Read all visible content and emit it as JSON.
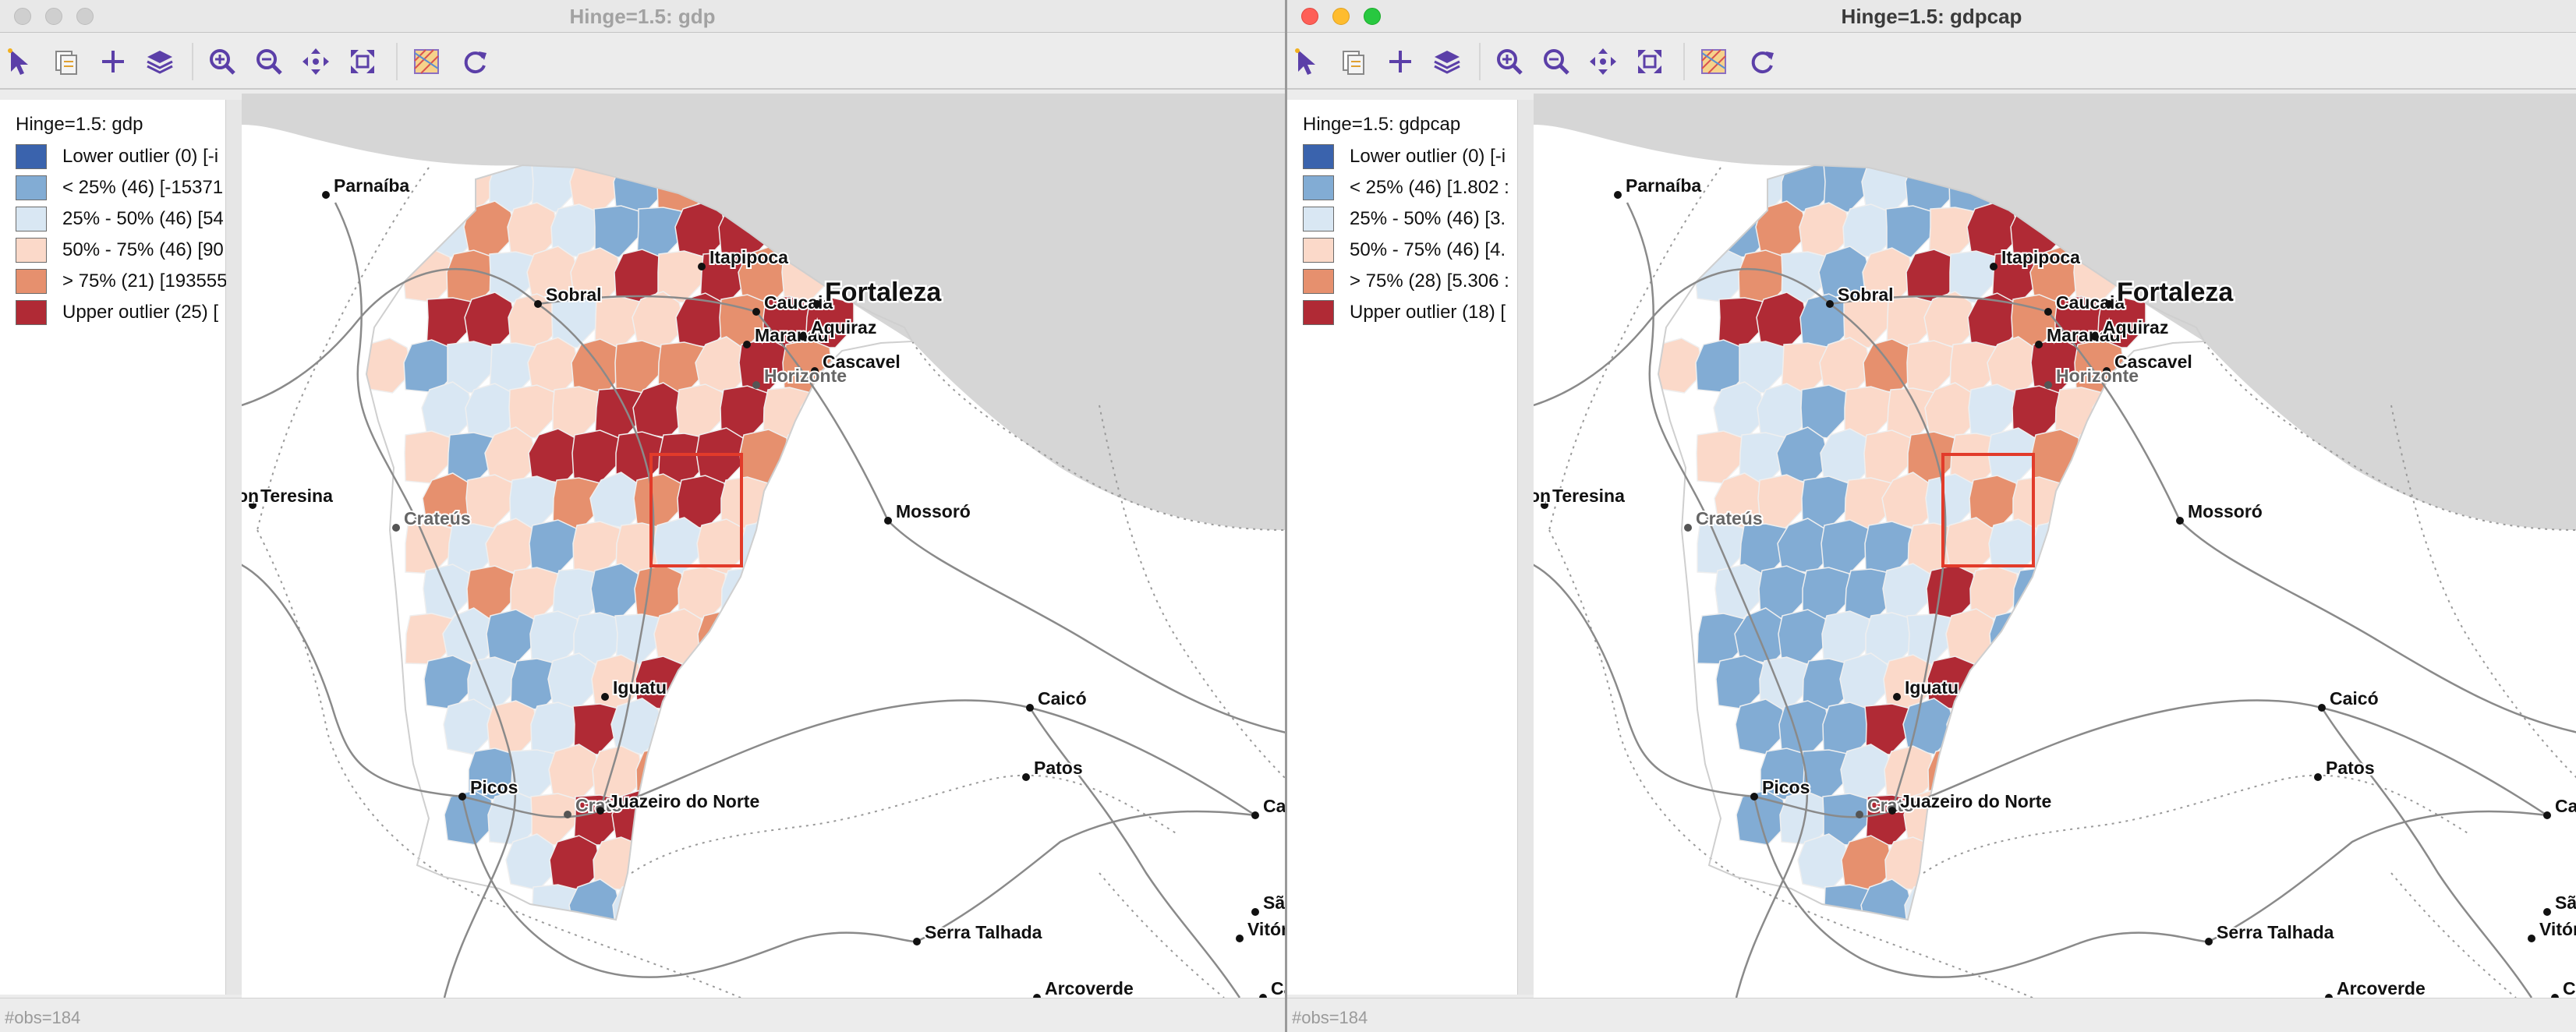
{
  "colors": {
    "lower_outlier": "#3a63ad",
    "q1": "#82acd4",
    "q2": "#d9e7f3",
    "q3": "#fbd9c9",
    "q4": "#e6906e",
    "upper_outlier": "#b02a35",
    "selection": "#e23b2a",
    "ocean": "#d6d6d6"
  },
  "toolbar_icons": [
    "pointer-icon",
    "copy-icon",
    "add-icon",
    "layers-icon",
    "zoom-in-icon",
    "zoom-out-icon",
    "pan-icon",
    "full-extent-icon",
    "basemap-icon",
    "refresh-icon"
  ],
  "cities": [
    "Parnaíba",
    "Sobral",
    "Itapipoca",
    "Caucaia",
    "Fortaleza",
    "Maranaú",
    "Aquiraz",
    "Cascavel",
    "Horizonte",
    "Teresina",
    "Crateús",
    "Mossoró",
    "Iguatu",
    "Caicó",
    "Picos",
    "Patos",
    "Campina Grande",
    "Crato",
    "Juazeiro do Norte",
    "São Lourenço",
    "Vitória de Santo A",
    "Serra Talhada",
    "Arcoverde",
    "Caru",
    "on"
  ],
  "left": {
    "title": "Hinge=1.5: gdp",
    "legend_title": "Hinge=1.5: gdp",
    "legend": [
      {
        "label": "Lower outlier (0)  [-i"
      },
      {
        "label": "< 25% (46)  [-15371"
      },
      {
        "label": "25% - 50% (46)  [54"
      },
      {
        "label": "50% - 75% (46)  [90"
      },
      {
        "label": "> 75% (21)  [193555"
      },
      {
        "label": "Upper outlier (25)  ["
      }
    ],
    "status": "#obs=184"
  },
  "right": {
    "title": "Hinge=1.5: gdpcap",
    "legend_title": "Hinge=1.5: gdpcap",
    "legend": [
      {
        "label": "Lower outlier (0)  [-i"
      },
      {
        "label": "< 25% (46)  [1.802 :"
      },
      {
        "label": "25% - 50% (46)  [3."
      },
      {
        "label": "50% - 75% (46)  [4."
      },
      {
        "label": "> 75% (28)  [5.306 :"
      },
      {
        "label": "Upper outlier (18)  ["
      }
    ],
    "status": "#obs=184"
  }
}
